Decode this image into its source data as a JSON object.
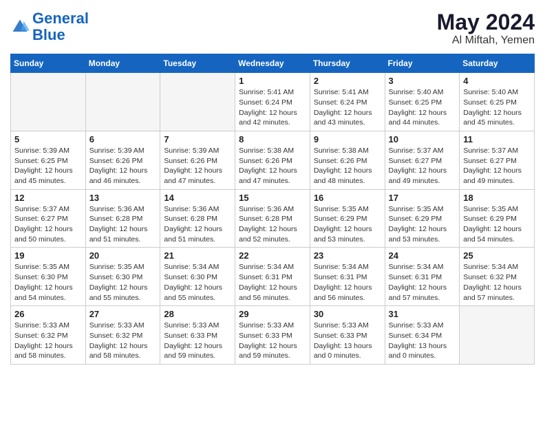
{
  "logo": {
    "line1": "General",
    "line2": "Blue"
  },
  "title": "May 2024",
  "location": "Al Miftah, Yemen",
  "days_of_week": [
    "Sunday",
    "Monday",
    "Tuesday",
    "Wednesday",
    "Thursday",
    "Friday",
    "Saturday"
  ],
  "weeks": [
    [
      {
        "day": "",
        "info": ""
      },
      {
        "day": "",
        "info": ""
      },
      {
        "day": "",
        "info": ""
      },
      {
        "day": "1",
        "info": "Sunrise: 5:41 AM\nSunset: 6:24 PM\nDaylight: 12 hours\nand 42 minutes."
      },
      {
        "day": "2",
        "info": "Sunrise: 5:41 AM\nSunset: 6:24 PM\nDaylight: 12 hours\nand 43 minutes."
      },
      {
        "day": "3",
        "info": "Sunrise: 5:40 AM\nSunset: 6:25 PM\nDaylight: 12 hours\nand 44 minutes."
      },
      {
        "day": "4",
        "info": "Sunrise: 5:40 AM\nSunset: 6:25 PM\nDaylight: 12 hours\nand 45 minutes."
      }
    ],
    [
      {
        "day": "5",
        "info": "Sunrise: 5:39 AM\nSunset: 6:25 PM\nDaylight: 12 hours\nand 45 minutes."
      },
      {
        "day": "6",
        "info": "Sunrise: 5:39 AM\nSunset: 6:26 PM\nDaylight: 12 hours\nand 46 minutes."
      },
      {
        "day": "7",
        "info": "Sunrise: 5:39 AM\nSunset: 6:26 PM\nDaylight: 12 hours\nand 47 minutes."
      },
      {
        "day": "8",
        "info": "Sunrise: 5:38 AM\nSunset: 6:26 PM\nDaylight: 12 hours\nand 47 minutes."
      },
      {
        "day": "9",
        "info": "Sunrise: 5:38 AM\nSunset: 6:26 PM\nDaylight: 12 hours\nand 48 minutes."
      },
      {
        "day": "10",
        "info": "Sunrise: 5:37 AM\nSunset: 6:27 PM\nDaylight: 12 hours\nand 49 minutes."
      },
      {
        "day": "11",
        "info": "Sunrise: 5:37 AM\nSunset: 6:27 PM\nDaylight: 12 hours\nand 49 minutes."
      }
    ],
    [
      {
        "day": "12",
        "info": "Sunrise: 5:37 AM\nSunset: 6:27 PM\nDaylight: 12 hours\nand 50 minutes."
      },
      {
        "day": "13",
        "info": "Sunrise: 5:36 AM\nSunset: 6:28 PM\nDaylight: 12 hours\nand 51 minutes."
      },
      {
        "day": "14",
        "info": "Sunrise: 5:36 AM\nSunset: 6:28 PM\nDaylight: 12 hours\nand 51 minutes."
      },
      {
        "day": "15",
        "info": "Sunrise: 5:36 AM\nSunset: 6:28 PM\nDaylight: 12 hours\nand 52 minutes."
      },
      {
        "day": "16",
        "info": "Sunrise: 5:35 AM\nSunset: 6:29 PM\nDaylight: 12 hours\nand 53 minutes."
      },
      {
        "day": "17",
        "info": "Sunrise: 5:35 AM\nSunset: 6:29 PM\nDaylight: 12 hours\nand 53 minutes."
      },
      {
        "day": "18",
        "info": "Sunrise: 5:35 AM\nSunset: 6:29 PM\nDaylight: 12 hours\nand 54 minutes."
      }
    ],
    [
      {
        "day": "19",
        "info": "Sunrise: 5:35 AM\nSunset: 6:30 PM\nDaylight: 12 hours\nand 54 minutes."
      },
      {
        "day": "20",
        "info": "Sunrise: 5:35 AM\nSunset: 6:30 PM\nDaylight: 12 hours\nand 55 minutes."
      },
      {
        "day": "21",
        "info": "Sunrise: 5:34 AM\nSunset: 6:30 PM\nDaylight: 12 hours\nand 55 minutes."
      },
      {
        "day": "22",
        "info": "Sunrise: 5:34 AM\nSunset: 6:31 PM\nDaylight: 12 hours\nand 56 minutes."
      },
      {
        "day": "23",
        "info": "Sunrise: 5:34 AM\nSunset: 6:31 PM\nDaylight: 12 hours\nand 56 minutes."
      },
      {
        "day": "24",
        "info": "Sunrise: 5:34 AM\nSunset: 6:31 PM\nDaylight: 12 hours\nand 57 minutes."
      },
      {
        "day": "25",
        "info": "Sunrise: 5:34 AM\nSunset: 6:32 PM\nDaylight: 12 hours\nand 57 minutes."
      }
    ],
    [
      {
        "day": "26",
        "info": "Sunrise: 5:33 AM\nSunset: 6:32 PM\nDaylight: 12 hours\nand 58 minutes."
      },
      {
        "day": "27",
        "info": "Sunrise: 5:33 AM\nSunset: 6:32 PM\nDaylight: 12 hours\nand 58 minutes."
      },
      {
        "day": "28",
        "info": "Sunrise: 5:33 AM\nSunset: 6:33 PM\nDaylight: 12 hours\nand 59 minutes."
      },
      {
        "day": "29",
        "info": "Sunrise: 5:33 AM\nSunset: 6:33 PM\nDaylight: 12 hours\nand 59 minutes."
      },
      {
        "day": "30",
        "info": "Sunrise: 5:33 AM\nSunset: 6:33 PM\nDaylight: 13 hours\nand 0 minutes."
      },
      {
        "day": "31",
        "info": "Sunrise: 5:33 AM\nSunset: 6:34 PM\nDaylight: 13 hours\nand 0 minutes."
      },
      {
        "day": "",
        "info": ""
      }
    ]
  ]
}
